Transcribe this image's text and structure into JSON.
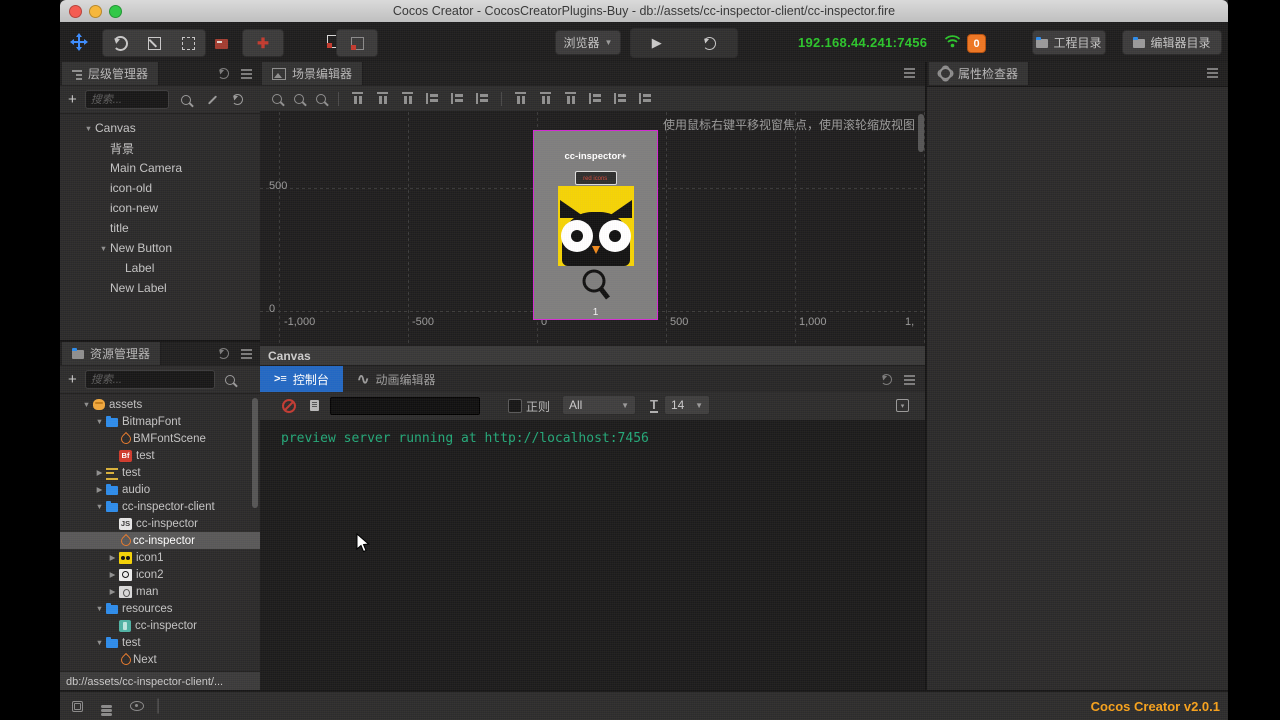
{
  "titlebar": {
    "title": "Cocos Creator - CocosCreatorPlugins-Buy - db://assets/cc-inspector-client/cc-inspector.fire"
  },
  "toolbar": {
    "preview_target": "浏览器",
    "ip": "192.168.44.241:7456",
    "badge": "0",
    "project_dir": "工程目录",
    "editor_dir": "编辑器目录",
    "tool_icons": [
      "move-tool-icon",
      "rotate-tool-icon",
      "scale-tool-icon",
      "rect-tool-icon"
    ],
    "plugin_icons": [
      "plugin-picture-icon",
      "plugin-plus-icon",
      "plugin-corner-icon",
      "plugin-corner-gray-icon"
    ]
  },
  "hierarchy": {
    "title": "层级管理器",
    "search_placeholder": "搜索...",
    "tree": [
      {
        "label": "Canvas",
        "depth": 0,
        "arrow": "down"
      },
      {
        "label": "背景",
        "depth": 1,
        "arrow": ""
      },
      {
        "label": "Main Camera",
        "depth": 1,
        "arrow": ""
      },
      {
        "label": "icon-old",
        "depth": 1,
        "arrow": ""
      },
      {
        "label": "icon-new",
        "depth": 1,
        "arrow": ""
      },
      {
        "label": "title",
        "depth": 1,
        "arrow": ""
      },
      {
        "label": "New Button",
        "depth": 1,
        "arrow": "down"
      },
      {
        "label": "Label",
        "depth": 2,
        "arrow": ""
      },
      {
        "label": "New Label",
        "depth": 1,
        "arrow": ""
      }
    ]
  },
  "assets": {
    "title": "资源管理器",
    "search_placeholder": "搜索...",
    "status_path": "db://assets/cc-inspector-client/...",
    "tree": [
      {
        "label": "assets",
        "depth": 0,
        "arrow": "down",
        "icon": "pot"
      },
      {
        "label": "BitmapFont",
        "depth": 1,
        "arrow": "down",
        "icon": "folder"
      },
      {
        "label": "BMFontScene",
        "depth": 2,
        "arrow": "",
        "icon": "fire"
      },
      {
        "label": "test",
        "depth": 2,
        "arrow": "",
        "icon": "bf"
      },
      {
        "label": "test",
        "depth": 1,
        "arrow": "right",
        "icon": "fontfile"
      },
      {
        "label": "audio",
        "depth": 1,
        "arrow": "right",
        "icon": "folder"
      },
      {
        "label": "cc-inspector-client",
        "depth": 1,
        "arrow": "down",
        "icon": "folder"
      },
      {
        "label": "cc-inspector",
        "depth": 2,
        "arrow": "",
        "icon": "js"
      },
      {
        "label": "cc-inspector",
        "depth": 2,
        "arrow": "",
        "icon": "fire",
        "selected": true
      },
      {
        "label": "icon1",
        "depth": 2,
        "arrow": "right",
        "icon": "owl"
      },
      {
        "label": "icon2",
        "depth": 2,
        "arrow": "right",
        "icon": "magimg"
      },
      {
        "label": "man",
        "depth": 2,
        "arrow": "right",
        "icon": "man"
      },
      {
        "label": "resources",
        "depth": 1,
        "arrow": "down",
        "icon": "folder"
      },
      {
        "label": "cc-inspector",
        "depth": 2,
        "arrow": "",
        "icon": "prefab"
      },
      {
        "label": "test",
        "depth": 1,
        "arrow": "down",
        "icon": "folder"
      },
      {
        "label": "Next",
        "depth": 2,
        "arrow": "",
        "icon": "fire"
      }
    ]
  },
  "scene": {
    "title": "场景编辑器",
    "hint": "使用鼠标右键平移视窗焦点，使用滚轮缩放视图",
    "ruler_x": [
      "-1,000",
      "-500",
      "0",
      "500",
      "1,000",
      "1,"
    ],
    "ruler_y": [
      "500",
      "0"
    ],
    "node_title": "cc-inspector+",
    "node_button": "red icons",
    "canvas_label": "1",
    "path_bar": "Canvas",
    "toolbar_icons": [
      "zoom-out-icon",
      "zoom-reset-icon",
      "zoom-in-icon",
      "sep",
      "align-top-icon",
      "align-v-center-icon",
      "align-bottom-icon",
      "align-left-icon",
      "align-h-center-icon",
      "align-right-icon",
      "sep",
      "distribute-top-icon",
      "distribute-v-center-icon",
      "distribute-bottom-icon",
      "distribute-left-icon",
      "distribute-h-center-icon",
      "distribute-right-icon"
    ]
  },
  "console": {
    "tab_console": "控制台",
    "tab_anim": "动画编辑器",
    "regex_label": "正则",
    "filter_value": "All",
    "fontsize_value": "14",
    "log": "preview server running at http://localhost:7456"
  },
  "inspector": {
    "title": "属性检查器"
  },
  "statusbar": {
    "version": "Cocos Creator v2.0.1"
  },
  "colors": {
    "accent_blue_tab": "#2268c3",
    "ip_green": "#2bc52b",
    "log_green": "#22a878",
    "canvas_border_magenta": "#d42ad4",
    "owl_yellow": "#f5d305",
    "version_orange": "#f7a21b",
    "badge_orange": "#ee7622",
    "folder_blue": "#2d8ceb",
    "fire_orange": "#e87a2c"
  }
}
